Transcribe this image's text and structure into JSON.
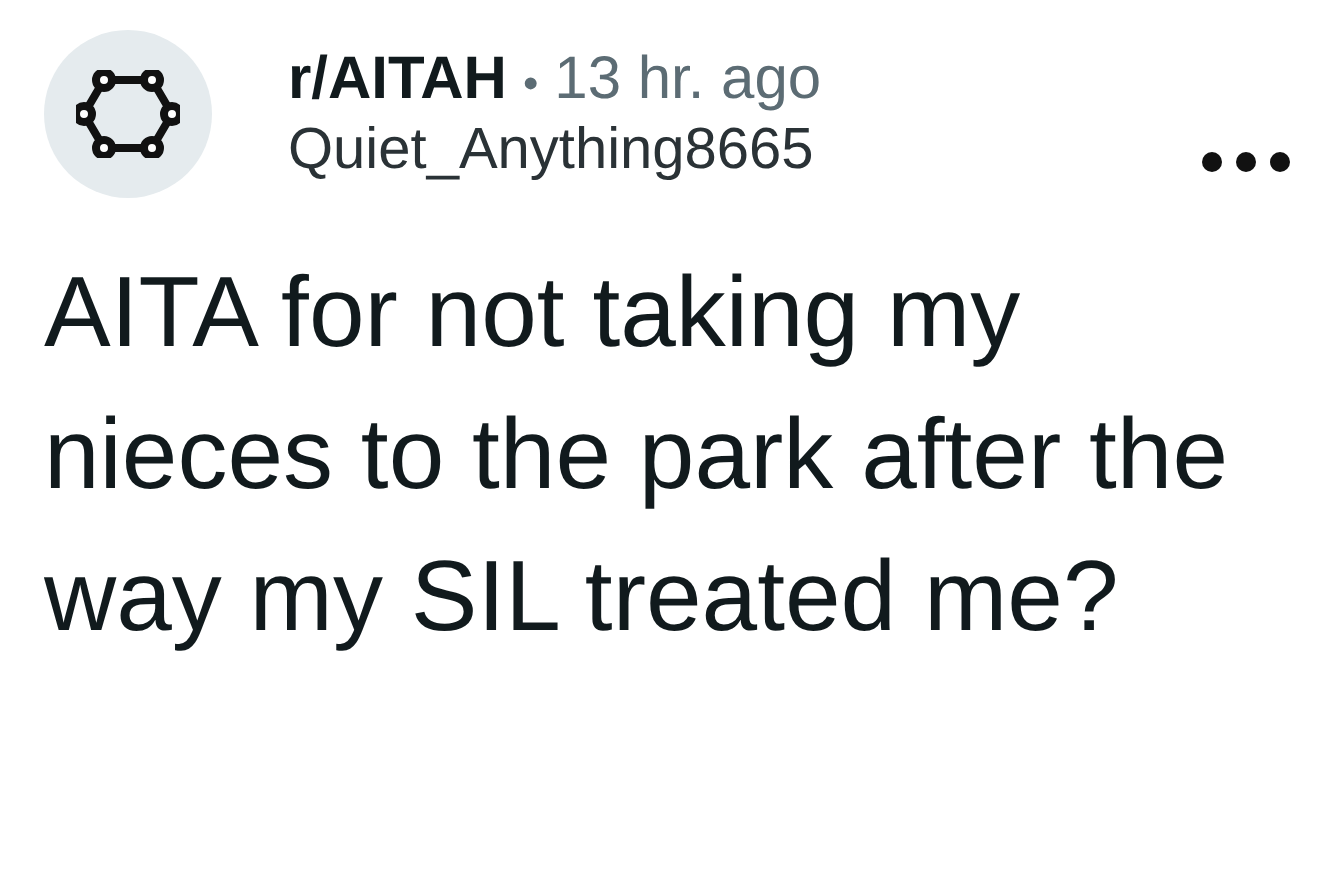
{
  "post": {
    "subreddit": "r/AITAH",
    "separator": "•",
    "time": "13 hr. ago",
    "author": "Quiet_Anything8665",
    "title": "AITA for not taking my nieces to the park after the way my SIL treated me?"
  }
}
